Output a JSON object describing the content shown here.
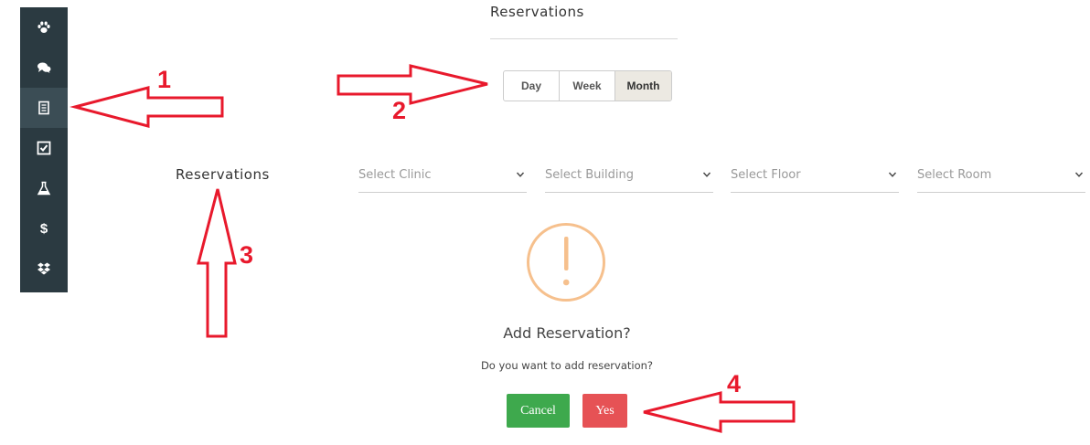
{
  "sidebar": {
    "items": [
      {
        "icon": "paw-icon",
        "active": false
      },
      {
        "icon": "chat-icon",
        "active": false
      },
      {
        "icon": "receipt-icon",
        "active": true
      },
      {
        "icon": "checklist-icon",
        "active": false
      },
      {
        "icon": "flask-icon",
        "active": false
      },
      {
        "icon": "dollar-icon",
        "active": false
      },
      {
        "icon": "dropbox-icon",
        "active": false
      }
    ],
    "dollar_glyph": "$"
  },
  "header": {
    "title": "Reservations"
  },
  "view_toggle": {
    "day": "Day",
    "week": "Week",
    "month": "Month",
    "selected": "Month"
  },
  "filters": {
    "section_label": "Reservations",
    "clinic_placeholder": "Select Clinic",
    "building_placeholder": "Select Building",
    "floor_placeholder": "Select Floor",
    "room_placeholder": "Select Room"
  },
  "dialog": {
    "icon": "warning-icon",
    "title": "Add Reservation?",
    "text": "Do you want to add reservation?",
    "cancel_label": "Cancel",
    "yes_label": "Yes"
  },
  "annotations": {
    "n1": "1",
    "n2": "2",
    "n3": "3",
    "n4": "4"
  },
  "colors": {
    "sidebar_bg": "#2b3a41",
    "cancel_green": "#3ea94d",
    "yes_red": "#e65255",
    "warning_orange": "#f6c08d",
    "annotation_red": "#e8192c"
  }
}
